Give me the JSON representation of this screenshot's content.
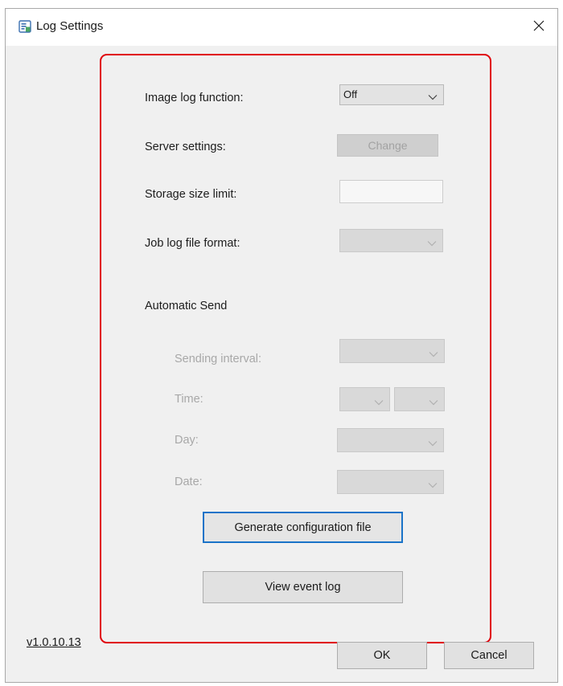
{
  "window": {
    "title": "Log Settings"
  },
  "settings": {
    "image_log_label": "Image log function:",
    "image_log_value": "Off",
    "server_label": "Server settings:",
    "change_button": "Change",
    "storage_label": "Storage size limit:",
    "storage_value": "",
    "job_log_format_label": "Job log file format:",
    "job_log_format_value": ""
  },
  "automatic_send": {
    "heading": "Automatic Send",
    "interval_label": "Sending interval:",
    "time_label": "Time:",
    "day_label": "Day:",
    "date_label": "Date:"
  },
  "actions": {
    "generate_config": "Generate configuration file",
    "view_event_log": "View event log"
  },
  "footer": {
    "version": "v1.0.10.13",
    "ok": "OK",
    "cancel": "Cancel"
  },
  "colors": {
    "highlight_border": "#e0000a",
    "focus_border": "#1a73c8",
    "window_bg": "#f0f0f0"
  },
  "icons": {
    "app": "log-settings-app-icon",
    "close": "close-icon",
    "dropdown": "chevron-down-icon"
  }
}
